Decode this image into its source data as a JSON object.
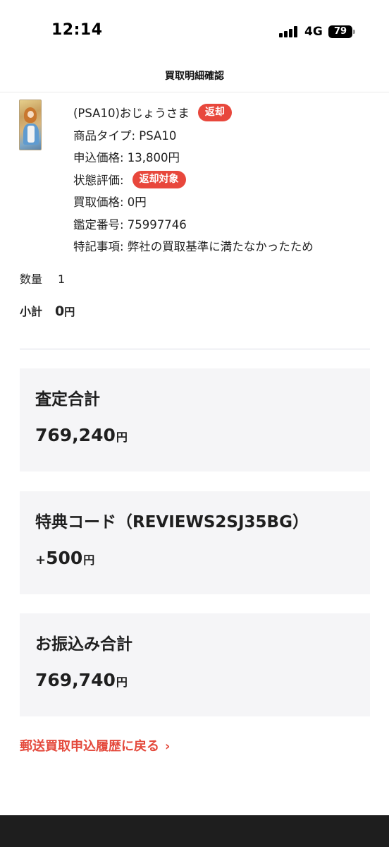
{
  "status_bar": {
    "time": "12:14",
    "network": "4G",
    "battery": "79"
  },
  "header": {
    "title": "買取明細確認"
  },
  "item": {
    "name": "(PSA10)おじょうさま",
    "return_badge": "返却",
    "product_type": "商品タイプ: PSA10",
    "application_price": "申込価格: 13,800円",
    "condition_label": "状態評価:",
    "condition_badge": "返却対象",
    "purchase_price": "買取価格: 0円",
    "grading_number": "鑑定番号: 75997746",
    "remarks": "特記事項: 弊社の買取基準に満たなかったため",
    "quantity_label": "数量",
    "quantity_value": "1",
    "subtotal_label": "小計",
    "subtotal_value": "0",
    "subtotal_unit": "円"
  },
  "summary": {
    "assessment_label": "査定合計",
    "assessment_value": "769,240",
    "assessment_unit": "円",
    "bonus_label": "特典コード（REVIEWS2SJ35BG）",
    "bonus_sign": "+",
    "bonus_value": "500",
    "bonus_unit": "円",
    "transfer_label": "お振込み合計",
    "transfer_value": "769,740",
    "transfer_unit": "円"
  },
  "back_link": {
    "label": "郵送買取申込履歴に戻る",
    "chevron": "›"
  },
  "colors": {
    "accent_red": "#e8473c",
    "card_bg": "#f5f5f7",
    "bottom_bar": "#1e1e1e"
  }
}
